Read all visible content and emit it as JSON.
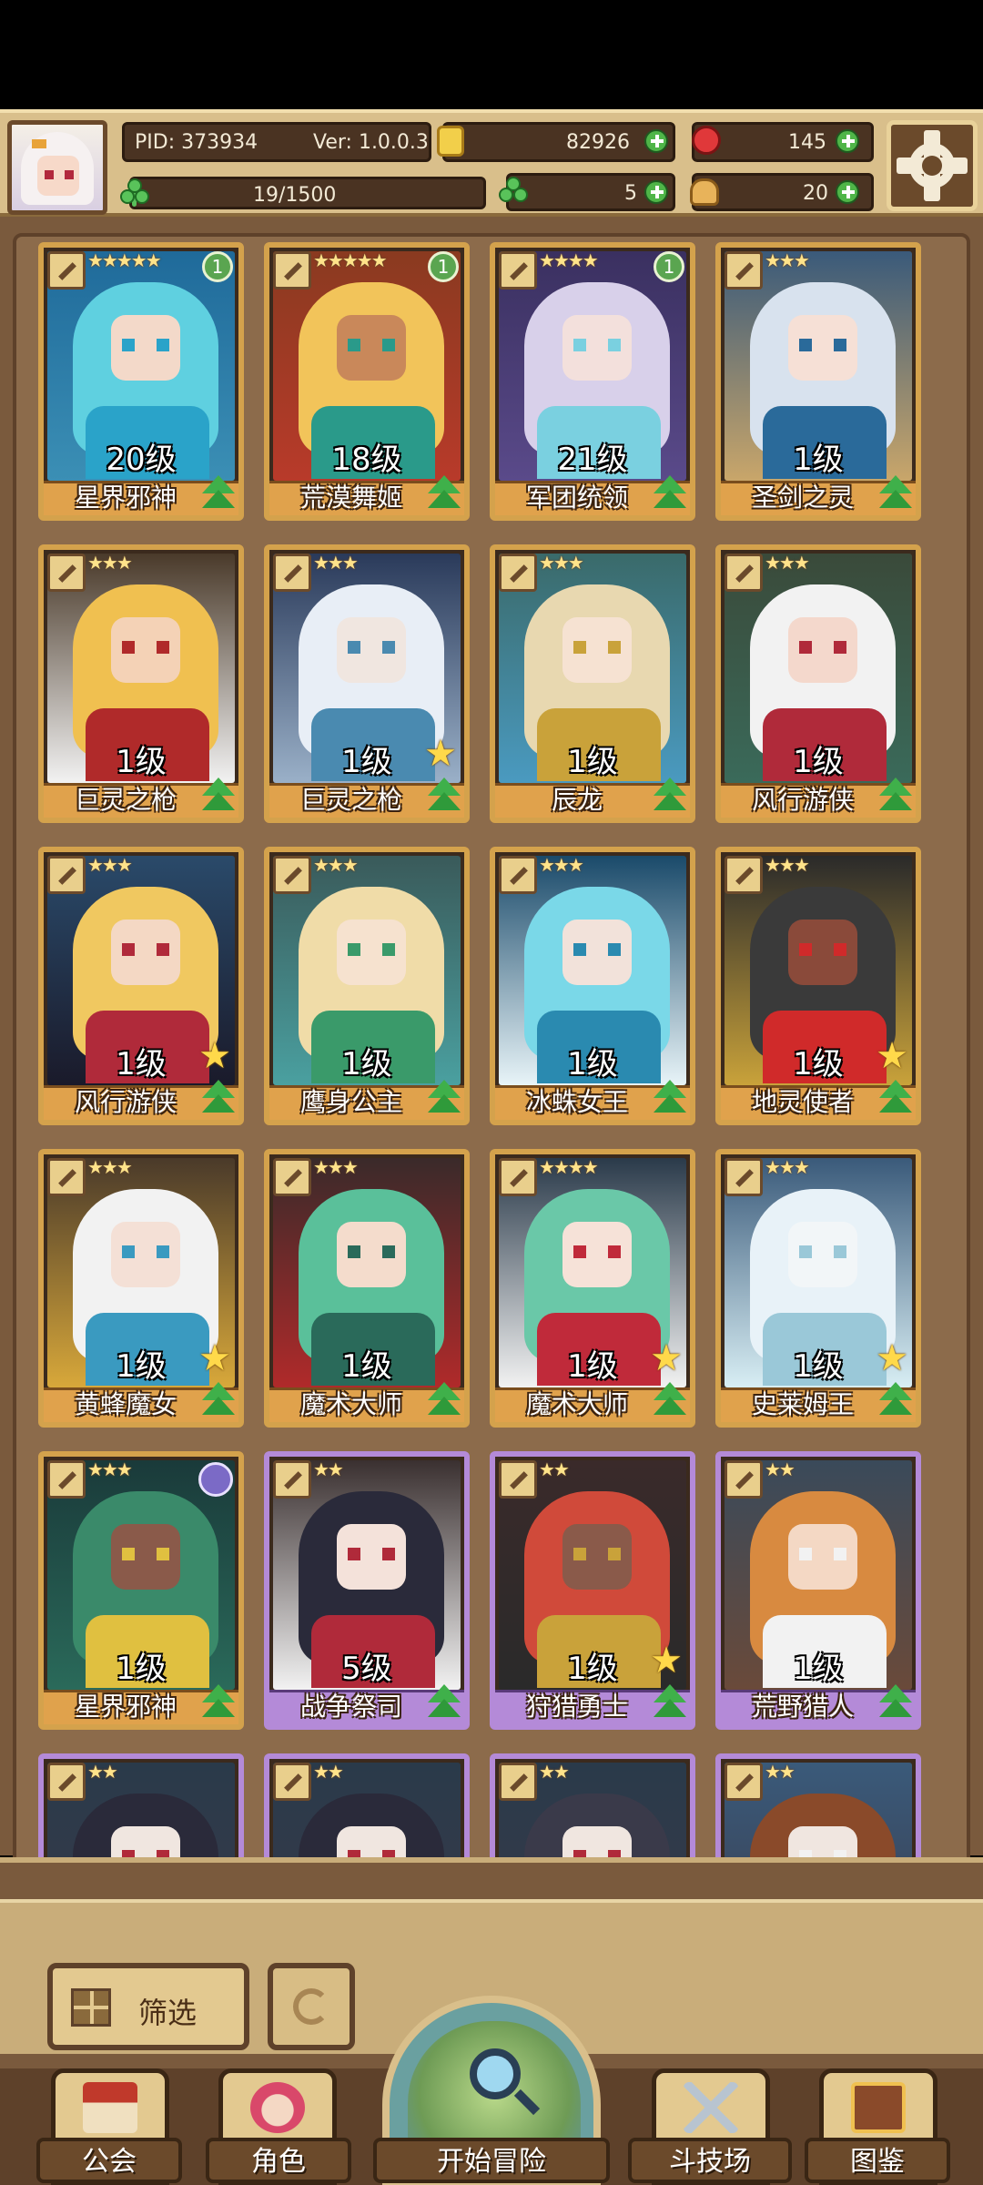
{
  "header": {
    "pid": "PID: 373934",
    "version": "Ver: 1.0.0.3",
    "gold": "82926",
    "gems": "145",
    "energy": "19/1500",
    "energy_fill": 0.0127,
    "clover": "5",
    "food": "20"
  },
  "cards": [
    {
      "name": "星界邪神",
      "level": "20级",
      "stars": "★★★★★",
      "frame": "gold",
      "notif": "1",
      "art": [
        "#1f6a9a",
        "#5fd0e0",
        "#f3d9c9",
        "#2aa3c9",
        "#3b8fb5"
      ]
    },
    {
      "name": "荒漠舞姬",
      "level": "18级",
      "stars": "★★★★★",
      "frame": "gold",
      "notif": "1",
      "art": [
        "#8a3a20",
        "#f2c45a",
        "#c9885a",
        "#2a9a8a",
        "#b83a2a"
      ]
    },
    {
      "name": "军团统领",
      "level": "21级",
      "stars": "★★★★",
      "frame": "gold",
      "notif": "1",
      "art": [
        "#3a3060",
        "#d8d0ea",
        "#f3e0dc",
        "#7ad0e0",
        "#5a4a8a"
      ]
    },
    {
      "name": "圣剑之灵",
      "level": "1级",
      "stars": "★★★",
      "frame": "gold",
      "notif": "",
      "art": [
        "#3a5a7a",
        "#d8e2ee",
        "#f6e0d6",
        "#2a6a9a",
        "#c9a66a"
      ]
    },
    {
      "name": "巨灵之枪",
      "level": "1级",
      "stars": "★★★",
      "frame": "gold",
      "notif": "",
      "art": [
        "#4a3a2a",
        "#f0c050",
        "#f4d2b6",
        "#b02a2a",
        "#f2f2f2"
      ]
    },
    {
      "name": "巨灵之枪",
      "level": "1级",
      "stars": "★★★",
      "frame": "gold",
      "notif": "",
      "star_badge": true,
      "art": [
        "#2a3a5a",
        "#e8eef6",
        "#f0e6e0",
        "#4a8ab0",
        "#9ab0c8"
      ]
    },
    {
      "name": "辰龙",
      "level": "1级",
      "stars": "★★★",
      "frame": "gold",
      "notif": "",
      "art": [
        "#3a6a6a",
        "#e8d8b0",
        "#f6e2d2",
        "#c9a23a",
        "#4a9ac0"
      ]
    },
    {
      "name": "风行游侠",
      "level": "1级",
      "stars": "★★★",
      "frame": "gold",
      "notif": "",
      "art": [
        "#3a4a3a",
        "#f2f2f2",
        "#f4d8cc",
        "#b02a3a",
        "#3a6a5a"
      ]
    },
    {
      "name": "风行游侠",
      "level": "1级",
      "stars": "★★★",
      "frame": "gold",
      "notif": "",
      "star_badge": true,
      "art": [
        "#2a4a6a",
        "#f0c860",
        "#f4d8c4",
        "#b02a3a",
        "#1a1a2a"
      ]
    },
    {
      "name": "鹰身公主",
      "level": "1级",
      "stars": "★★★",
      "frame": "gold",
      "notif": "",
      "art": [
        "#3a5a5a",
        "#f0dca8",
        "#f6e2cf",
        "#3a9a6a",
        "#4aa0a0"
      ]
    },
    {
      "name": "冰蛛女王",
      "level": "1级",
      "stars": "★★★",
      "frame": "gold",
      "notif": "",
      "art": [
        "#1a4a6a",
        "#7ad8e8",
        "#f2e2da",
        "#2a8ab0",
        "#e8f4f8"
      ]
    },
    {
      "name": "地灵使者",
      "level": "1级",
      "stars": "★★★",
      "frame": "gold",
      "notif": "",
      "star_badge": true,
      "art": [
        "#2a2a2a",
        "#3a3a3a",
        "#8a4a3a",
        "#d02a2a",
        "#c9a23a"
      ]
    },
    {
      "name": "黄蜂魔女",
      "level": "1级",
      "stars": "★★★",
      "frame": "gold",
      "notif": "",
      "star_badge": true,
      "art": [
        "#4a3a2a",
        "#f2f2f2",
        "#f4e0d6",
        "#3a9ac0",
        "#d8a83a"
      ]
    },
    {
      "name": "魔术大师",
      "level": "1级",
      "stars": "★★★",
      "frame": "gold",
      "notif": "",
      "art": [
        "#3a2a2a",
        "#5ac09a",
        "#f4dccc",
        "#2a6a5a",
        "#b02a2a"
      ]
    },
    {
      "name": "魔术大师",
      "level": "1级",
      "stars": "★★★★",
      "frame": "gold",
      "notif": "",
      "star_badge": true,
      "art": [
        "#2a3a4a",
        "#6ac8a8",
        "#f6e2d8",
        "#c02a3a",
        "#f2f2f2"
      ]
    },
    {
      "name": "史莱姆王",
      "level": "1级",
      "stars": "★★★",
      "frame": "gold",
      "notif": "",
      "star_badge": true,
      "art": [
        "#3a5a7a",
        "#e8f2f8",
        "#f2f6f8",
        "#9ac8d8",
        "#d8eef4"
      ]
    },
    {
      "name": "星界邪神",
      "level": "1级",
      "stars": "★★★",
      "frame": "gold",
      "notif": "",
      "orb": true,
      "art": [
        "#1a3a3a",
        "#3a8a6a",
        "#8a5a4a",
        "#e0c040",
        "#2a6a5a"
      ]
    },
    {
      "name": "战争祭司",
      "level": "5级",
      "stars": "★★",
      "frame": "purple",
      "notif": "",
      "art": [
        "#3a3030",
        "#2a2a3a",
        "#f4e2da",
        "#b02a3a",
        "#f2f2f2"
      ]
    },
    {
      "name": "狩猎勇士",
      "level": "1级",
      "stars": "★★",
      "frame": "purple",
      "notif": "",
      "star_badge": true,
      "art": [
        "#3a2a2a",
        "#d04a3a",
        "#8a5a4a",
        "#c9a23a",
        "#2a2a2a"
      ]
    },
    {
      "name": "荒野猎人",
      "level": "1级",
      "stars": "★★",
      "frame": "purple",
      "notif": "",
      "art": [
        "#3a4a5a",
        "#d88a40",
        "#f4d8c4",
        "#f2f2f2",
        "#6a4a3a"
      ]
    },
    {
      "name": "",
      "level": "",
      "stars": "★★",
      "frame": "purple",
      "notif": "",
      "art": [
        "#2a3a4a",
        "#2a2a3a",
        "#f0e6e0",
        "#b02a3a",
        "#3a3a4a"
      ]
    },
    {
      "name": "",
      "level": "",
      "stars": "★★",
      "frame": "purple",
      "notif": "",
      "art": [
        "#2a3a4a",
        "#2a2a3a",
        "#f0e6e0",
        "#b02a3a",
        "#3a3a4a"
      ]
    },
    {
      "name": "",
      "level": "",
      "stars": "★★",
      "frame": "purple",
      "notif": "",
      "art": [
        "#2a3a4a",
        "#3a3a4a",
        "#f0e6e0",
        "#b02a3a",
        "#3a3a4a"
      ]
    },
    {
      "name": "",
      "level": "",
      "stars": "★★",
      "frame": "purple",
      "notif": "",
      "art": [
        "#3a5a7a",
        "#8a4a2a",
        "#f0e6e0",
        "#f2f2f2",
        "#3a3a4a"
      ]
    }
  ],
  "toolbar": {
    "filter_label": "筛选"
  },
  "nav": {
    "guild": "公会",
    "character": "角色",
    "adventure": "开始冒险",
    "arena": "斗技场",
    "codex": "图鉴"
  }
}
